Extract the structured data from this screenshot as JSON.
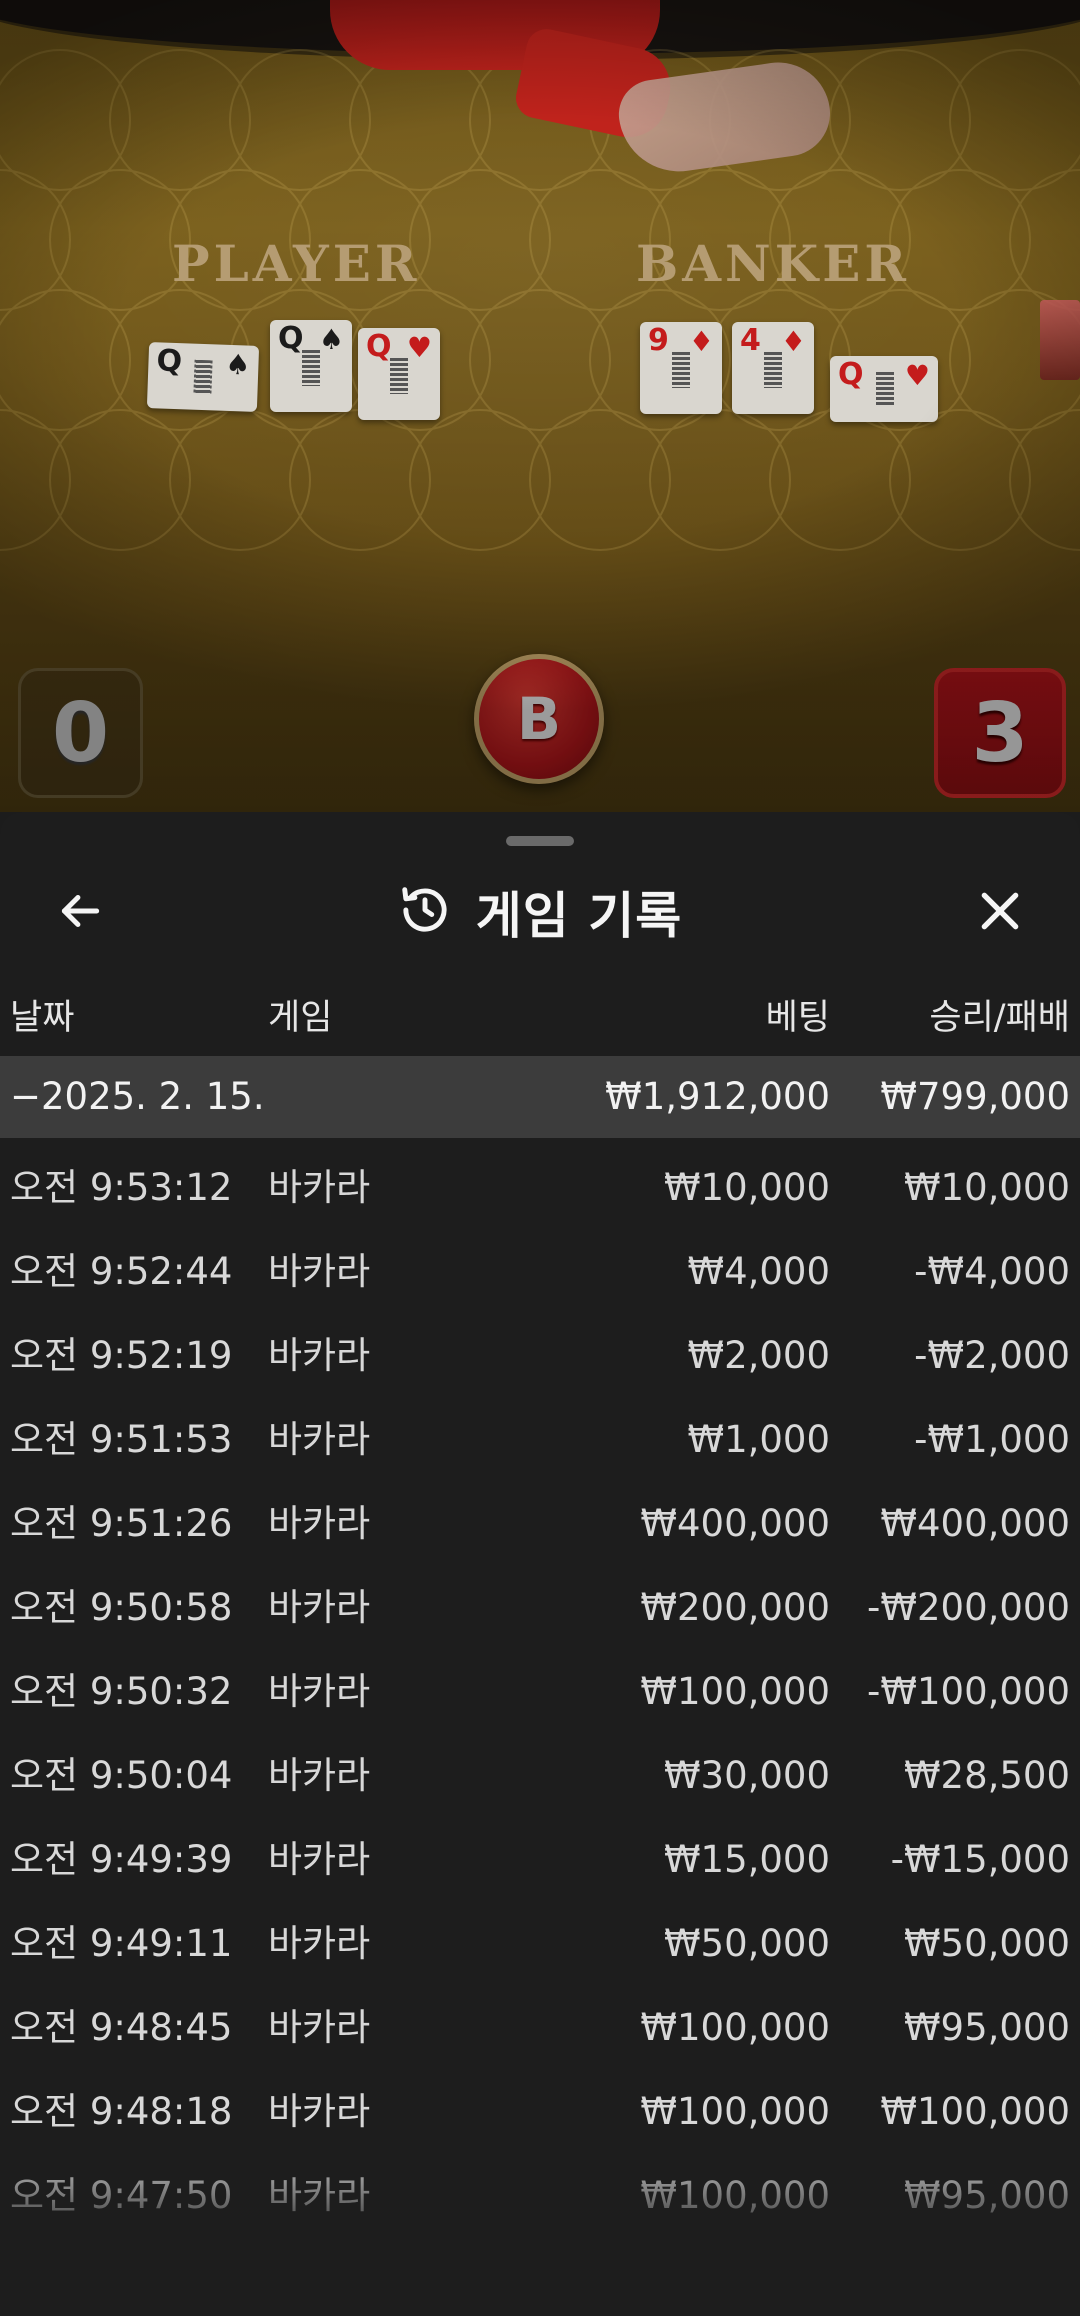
{
  "game_view": {
    "player_label": "PLAYER",
    "banker_label": "BANKER",
    "player_cards": [
      {
        "rank": "Q",
        "suit": "♠",
        "color": "black"
      },
      {
        "rank": "Q",
        "suit": "♠",
        "color": "black"
      },
      {
        "rank": "Q",
        "suit": "♥",
        "color": "red"
      }
    ],
    "banker_cards": [
      {
        "rank": "9",
        "suit": "♦",
        "color": "red"
      },
      {
        "rank": "4",
        "suit": "♦",
        "color": "red"
      },
      {
        "rank": "Q",
        "suit": "♥",
        "color": "red"
      }
    ],
    "player_score": "0",
    "banker_score": "3",
    "result_chip": "B"
  },
  "history": {
    "title": "게임 기록",
    "columns": {
      "date": "날짜",
      "game": "게임",
      "bet": "베팅",
      "win_loss": "승리/패배"
    },
    "summary": {
      "date": "−2025. 2. 15.",
      "bet": "₩1,912,000",
      "win_loss": "₩799,000"
    },
    "rows": [
      {
        "time": "오전 9:53:12",
        "game": "바카라",
        "bet": "₩10,000",
        "win_loss": "₩10,000"
      },
      {
        "time": "오전 9:52:44",
        "game": "바카라",
        "bet": "₩4,000",
        "win_loss": "-₩4,000"
      },
      {
        "time": "오전 9:52:19",
        "game": "바카라",
        "bet": "₩2,000",
        "win_loss": "-₩2,000"
      },
      {
        "time": "오전 9:51:53",
        "game": "바카라",
        "bet": "₩1,000",
        "win_loss": "-₩1,000"
      },
      {
        "time": "오전 9:51:26",
        "game": "바카라",
        "bet": "₩400,000",
        "win_loss": "₩400,000"
      },
      {
        "time": "오전 9:50:58",
        "game": "바카라",
        "bet": "₩200,000",
        "win_loss": "-₩200,000"
      },
      {
        "time": "오전 9:50:32",
        "game": "바카라",
        "bet": "₩100,000",
        "win_loss": "-₩100,000"
      },
      {
        "time": "오전 9:50:04",
        "game": "바카라",
        "bet": "₩30,000",
        "win_loss": "₩28,500"
      },
      {
        "time": "오전 9:49:39",
        "game": "바카라",
        "bet": "₩15,000",
        "win_loss": "-₩15,000"
      },
      {
        "time": "오전 9:49:11",
        "game": "바카라",
        "bet": "₩50,000",
        "win_loss": "₩50,000"
      },
      {
        "time": "오전 9:48:45",
        "game": "바카라",
        "bet": "₩100,000",
        "win_loss": "₩95,000"
      },
      {
        "time": "오전 9:48:18",
        "game": "바카라",
        "bet": "₩100,000",
        "win_loss": "₩100,000"
      },
      {
        "time": "오전 9:47:50",
        "game": "바카라",
        "bet": "₩100,000",
        "win_loss": "₩95,000"
      }
    ]
  },
  "icons": {
    "back": "arrow-left-icon",
    "history": "history-clock-icon",
    "close": "close-icon"
  },
  "colors": {
    "sheet_bg": "#1d1d1d",
    "summary_bg": "#3c3c3c",
    "banker_red": "#b3141a",
    "felt": "#7a5f1b"
  }
}
